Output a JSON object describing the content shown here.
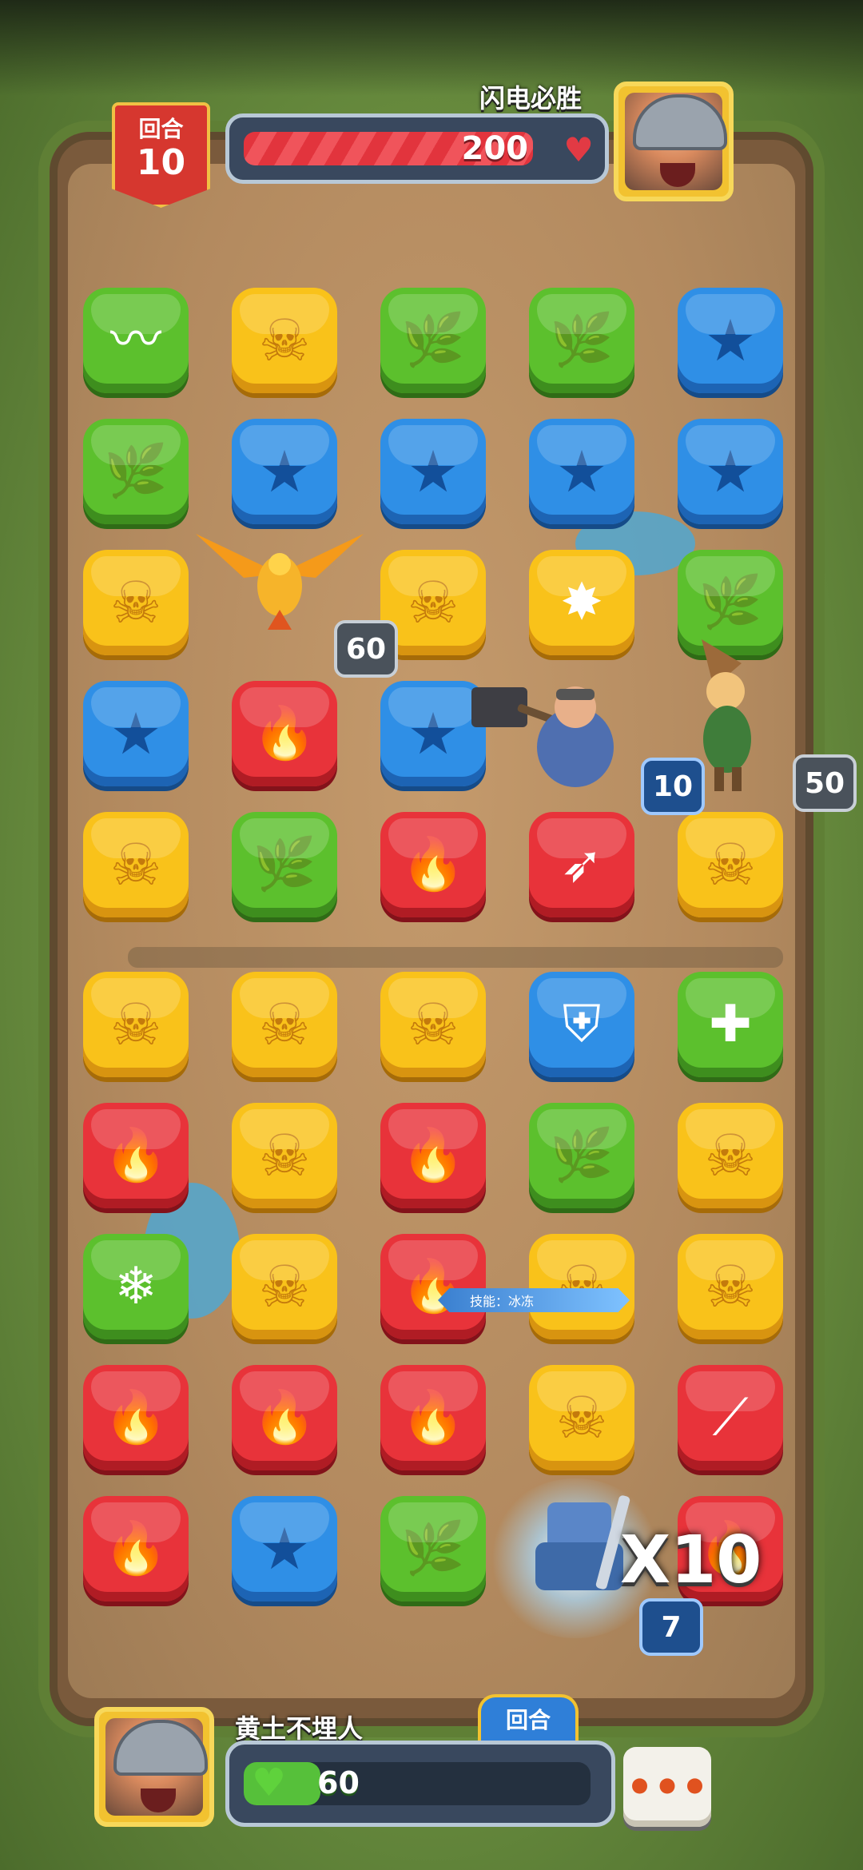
{
  "hud": {
    "round_label": "回合",
    "round_number": "10",
    "enemy_name": "闪电必胜",
    "enemy_hp": "200",
    "enemy_hp_fraction": 0.9,
    "player_name": "黄土不埋人",
    "player_hp": "60",
    "player_hp_fraction": 0.22,
    "turn_tab_label": "回合",
    "menu_label": "•••"
  },
  "board": {
    "rows": [
      [
        "special-green-wind",
        "yellow-skull",
        "green-leaf",
        "green-leaf",
        "blue-star"
      ],
      [
        "green-leaf",
        "blue-star",
        "blue-star",
        "blue-star",
        "blue-star"
      ],
      [
        "yellow-skull",
        "empty",
        "yellow-skull",
        "special-yellow-blast",
        "green-leaf"
      ],
      [
        "blue-star",
        "red-fire",
        "blue-star",
        "empty",
        "empty"
      ],
      [
        "yellow-skull",
        "green-leaf",
        "red-fire",
        "special-red-slash",
        "yellow-skull"
      ],
      [
        "yellow-skull",
        "yellow-skull",
        "yellow-skull",
        "special-blue-shield",
        "special-green-heal"
      ],
      [
        "red-fire",
        "yellow-skull",
        "red-fire",
        "green-leaf",
        "yellow-skull"
      ],
      [
        "special-green-snowflake",
        "yellow-skull",
        "red-fire",
        "yellow-skull",
        "yellow-skull"
      ],
      [
        "red-fire",
        "red-fire",
        "red-fire",
        "yellow-skull",
        "special-red-claw"
      ],
      [
        "red-fire",
        "blue-star",
        "green-leaf",
        "empty",
        "red-fire"
      ]
    ]
  },
  "units": {
    "phoenix_value": "60",
    "warrior_value": "10",
    "archer_value": "50",
    "knight_value": "7",
    "combo_text": "X10"
  },
  "skill_tip": "技能：冰冻",
  "colors": {
    "green": "#5cc02d",
    "yellow": "#f9c21a",
    "blue": "#2f8fe6",
    "red": "#e8333a",
    "hp_red": "#e2343d",
    "hp_green": "#56c03a"
  }
}
